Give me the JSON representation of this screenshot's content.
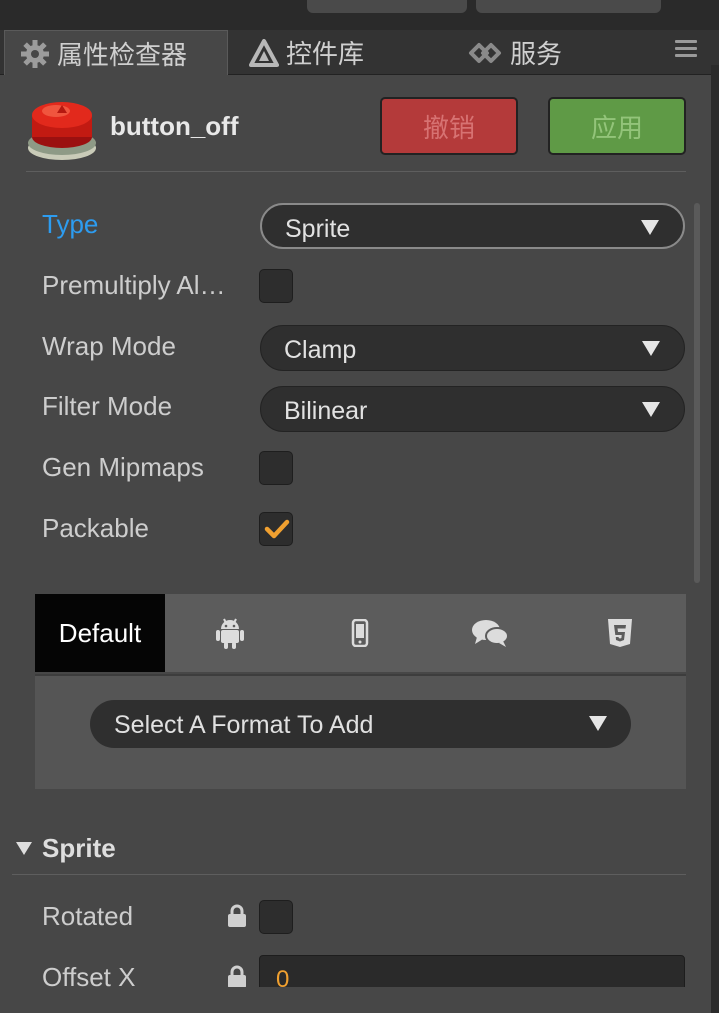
{
  "tabs": [
    {
      "label": "属性检查器",
      "icon": "gear-icon",
      "active": true
    },
    {
      "label": "控件库",
      "icon": "triangle-icon",
      "active": false
    },
    {
      "label": "服务",
      "icon": "cloud-link-icon",
      "active": false
    }
  ],
  "asset": {
    "name": "button_off",
    "revert_label": "撤销",
    "apply_label": "应用",
    "thumbnail_icon": "red-button-icon"
  },
  "properties": {
    "type_label": "Type",
    "type_value": "Sprite",
    "premultiply_label": "Premultiply Al…",
    "premultiply_checked": false,
    "wrap_label": "Wrap Mode",
    "wrap_value": "Clamp",
    "filter_label": "Filter Mode",
    "filter_value": "Bilinear",
    "mipmaps_label": "Gen Mipmaps",
    "mipmaps_checked": false,
    "packable_label": "Packable",
    "packable_checked": true
  },
  "platforms": {
    "tabs": [
      {
        "label": "Default",
        "icon": "",
        "active": true
      },
      {
        "label": "",
        "icon": "android-icon",
        "active": false
      },
      {
        "label": "",
        "icon": "mobile-phone-icon",
        "active": false
      },
      {
        "label": "",
        "icon": "chat-bubbles-icon",
        "active": false
      },
      {
        "label": "",
        "icon": "html5-icon",
        "active": false
      }
    ],
    "format_placeholder": "Select A Format To Add"
  },
  "sprite_section": {
    "title": "Sprite",
    "rotated_label": "Rotated",
    "rotated_checked": false,
    "offset_x_label": "Offset X",
    "offset_x_value": "0"
  },
  "colors": {
    "accent_blue": "#2d9cf0",
    "revert_red": "#b43a3a",
    "apply_green": "#5f9a46",
    "check_orange": "#f0a030"
  }
}
